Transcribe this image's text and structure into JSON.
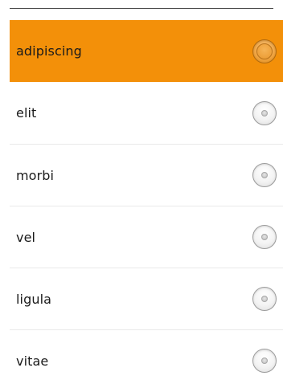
{
  "list": {
    "selected_index": 0,
    "items": [
      {
        "label": "adipiscing"
      },
      {
        "label": "elit"
      },
      {
        "label": "morbi"
      },
      {
        "label": "vel"
      },
      {
        "label": "ligula"
      },
      {
        "label": "vitae"
      }
    ]
  },
  "colors": {
    "selected_background": "#f39009",
    "divider": "#e9e9e9",
    "top_rule": "#4a4a4a"
  },
  "icons": {
    "radio": "radio-button-icon"
  }
}
